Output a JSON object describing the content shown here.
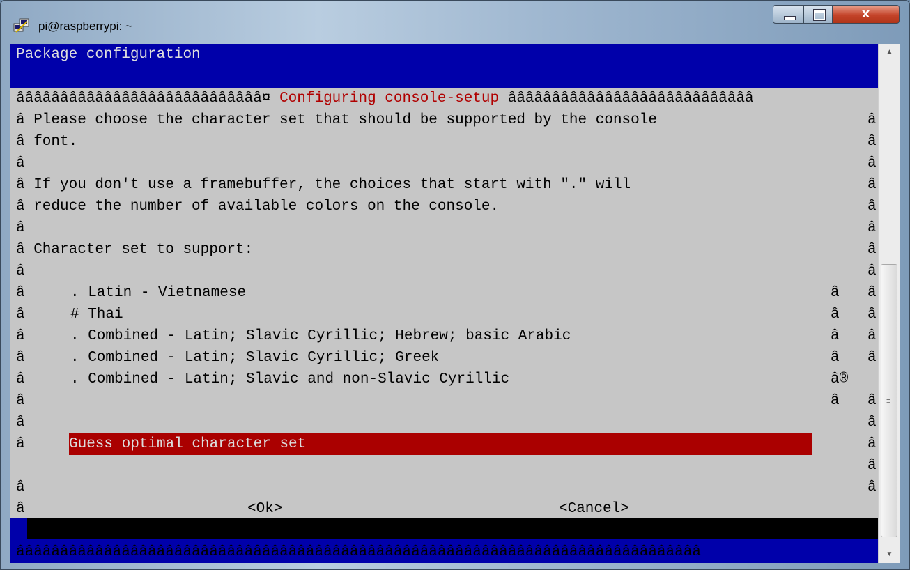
{
  "window": {
    "title": "pi@raspberrypi: ~",
    "icon": "putty-icon",
    "controls": {
      "minimize": "minimize-icon",
      "maximize": "maximize-icon",
      "close_label": "x"
    }
  },
  "terminal": {
    "title": "Package configuration",
    "dialog": {
      "header_left": "ââââââââââââââââââââââââââââ¤ ",
      "header_title": "Configuring console-setup",
      "header_right": " ââââââââââââââââââââââââââââ",
      "border_char": "â",
      "text_lines": [
        "Please choose the character set that should be supported by the console",
        "font.",
        "",
        "If you don't use a framebuffer, the choices that start with \".\" will",
        "reduce the number of available colors on the console.",
        "",
        "Character set to support:",
        ""
      ],
      "options": [
        {
          "label": ". Latin - Vietnamese",
          "mark": "â"
        },
        {
          "label": "# Thai",
          "mark": "â"
        },
        {
          "label": ". Combined - Latin; Slavic Cyrillic; Hebrew; basic Arabic",
          "mark": "â"
        },
        {
          "label": ". Combined - Latin; Slavic Cyrillic; Greek",
          "mark": "â"
        },
        {
          "label": ". Combined - Latin; Slavic and non-Slavic Cyrillic",
          "mark": "â®"
        },
        {
          "label": "Guess optimal character set",
          "mark": "â",
          "selected": true
        }
      ],
      "ok_label": "<Ok>",
      "cancel_label": "<Cancel>",
      "bottom_border": "ââââââââââââââââââââââââââââââââââââââââââââââââââââââââââââââââââââââââââââââ"
    }
  },
  "colors": {
    "terminal_bg": "#0000aa",
    "dialog_bg": "#c6c6c6",
    "title_red": "#b00000",
    "selection_bg": "#aa0000"
  }
}
